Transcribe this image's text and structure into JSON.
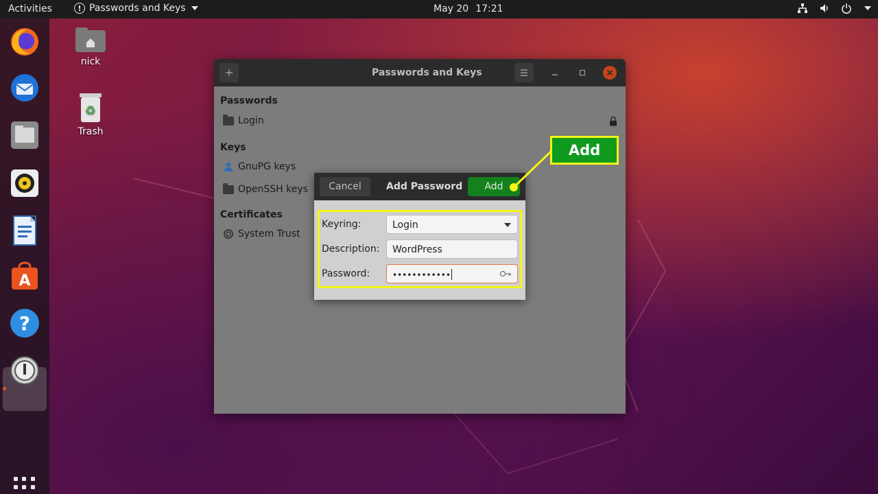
{
  "topbar": {
    "activities": "Activities",
    "app_name": "Passwords and Keys",
    "date": "May 20",
    "time": "17:21"
  },
  "desktop": {
    "home_label": "nick",
    "trash_label": "Trash"
  },
  "dock": {
    "items": [
      "Firefox",
      "Thunderbird",
      "Files",
      "Rhythmbox",
      "LibreOffice Writer",
      "Ubuntu Software",
      "Help",
      "Passwords and Keys"
    ]
  },
  "window": {
    "title": "Passwords and Keys",
    "sections": {
      "passwords": "Passwords",
      "login": "Login",
      "keys": "Keys",
      "gnupg": "GnuPG keys",
      "openssh": "OpenSSH keys",
      "certificates": "Certificates",
      "system_trust": "System Trust"
    }
  },
  "dialog": {
    "cancel": "Cancel",
    "title": "Add Password",
    "add": "Add",
    "keyring_label": "Keyring:",
    "keyring_value": "Login",
    "description_label": "Description:",
    "description_value": "WordPress",
    "password_label": "Password:",
    "password_value": "••••••••••••"
  },
  "callout": {
    "label": "Add"
  },
  "colors": {
    "accent_green": "#14801e",
    "highlight_yellow": "#f5f516",
    "ubuntu_orange": "#e95420"
  }
}
